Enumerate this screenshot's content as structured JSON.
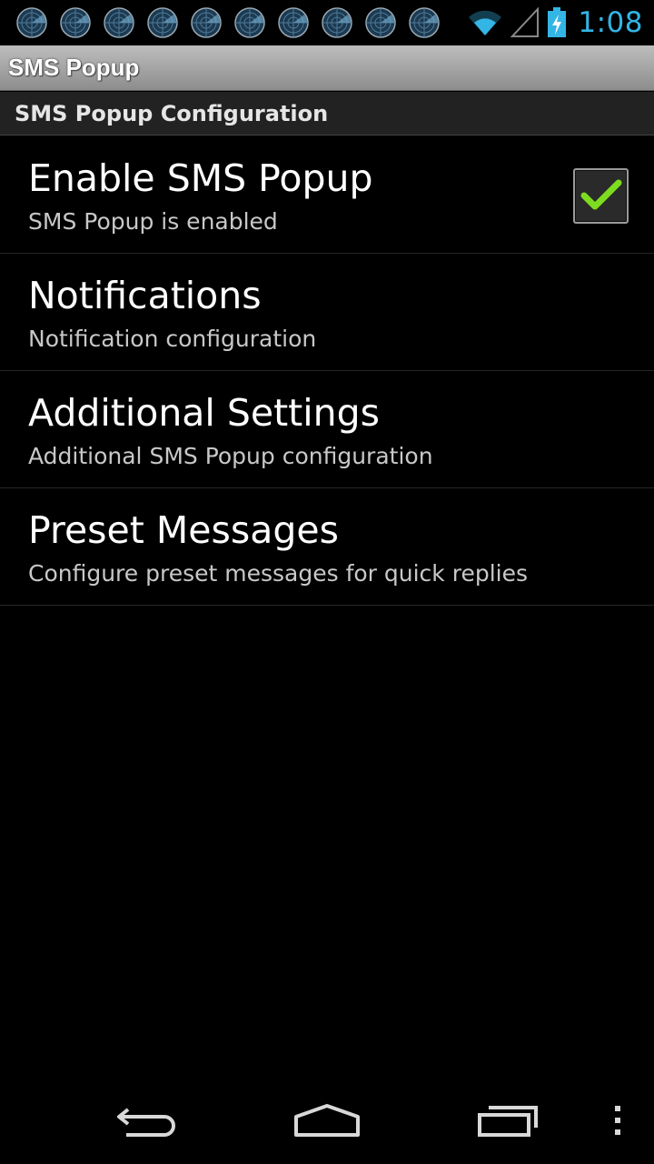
{
  "status_bar": {
    "time": "1:08",
    "notification_icons": [
      "radar-icon",
      "radar-icon",
      "radar-icon",
      "radar-icon",
      "radar-icon",
      "radar-icon",
      "radar-icon",
      "radar-icon",
      "radar-icon",
      "radar-icon"
    ],
    "accent_color": "#33b5e5"
  },
  "title_bar": {
    "title": "SMS Popup"
  },
  "category": {
    "label": "SMS Popup Configuration"
  },
  "preferences": [
    {
      "title": "Enable SMS Popup",
      "summary": "SMS Popup is enabled",
      "checked": true
    },
    {
      "title": "Notifications",
      "summary": "Notification configuration"
    },
    {
      "title": "Additional Settings",
      "summary": "Additional SMS Popup configuration"
    },
    {
      "title": "Preset Messages",
      "summary": "Configure preset messages for quick replies"
    }
  ],
  "nav_bar": {
    "icons": [
      "back-icon",
      "home-icon",
      "recent-apps-icon",
      "overflow-menu-icon"
    ]
  }
}
